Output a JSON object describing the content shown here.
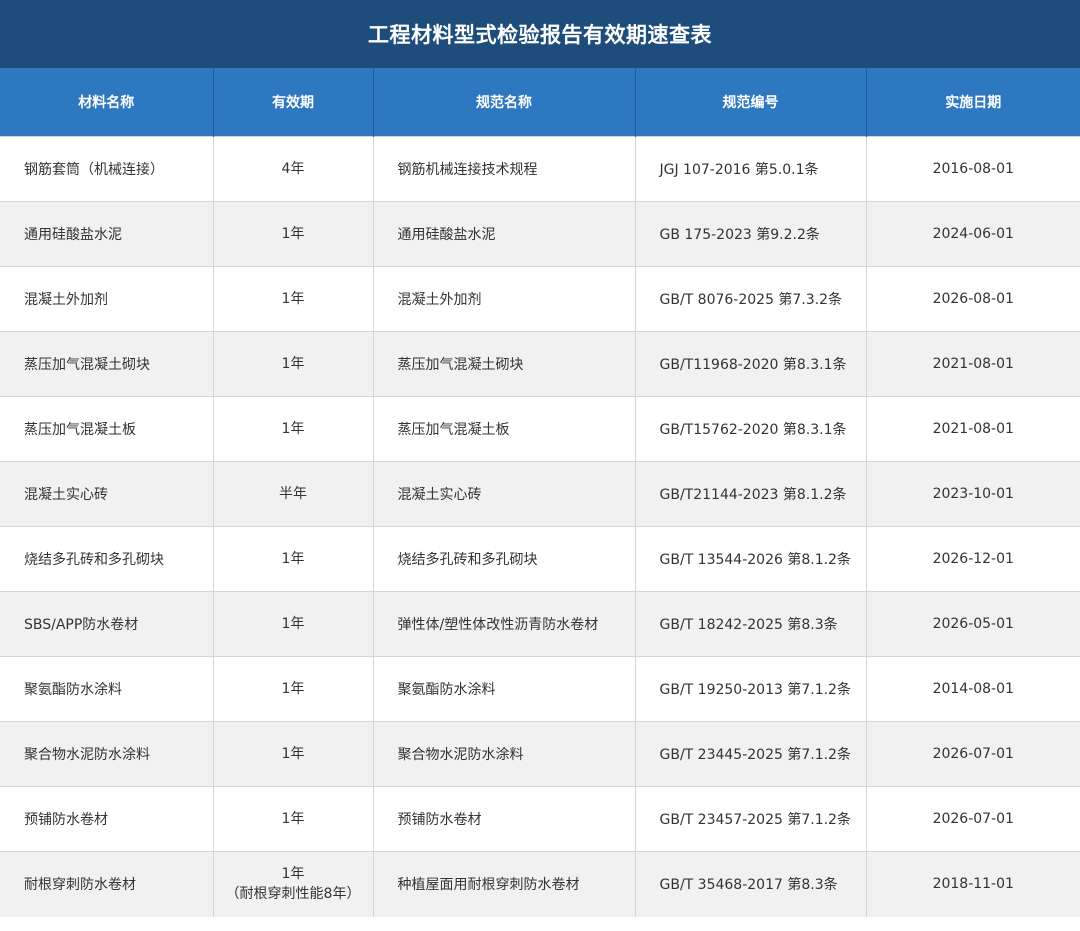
{
  "title": "工程材料型式检验报告有效期速查表",
  "colors": {
    "title_bg": "#1e4d7b",
    "header_bg": "#2e78c2",
    "row_alt_bg": "#f1f1f1"
  },
  "headers": [
    "材料名称",
    "有效期",
    "规范名称",
    "规范编号",
    "实施日期"
  ],
  "rows": [
    {
      "material": "钢筋套筒（机械连接）",
      "period": "4年",
      "period_note": "",
      "spec_name": "钢筋机械连接技术规程",
      "spec_no": "JGJ 107-2016 第5.0.1条",
      "date": "2016-08-01"
    },
    {
      "material": "通用硅酸盐水泥",
      "period": "1年",
      "period_note": "",
      "spec_name": "通用硅酸盐水泥",
      "spec_no": "GB 175-2023 第9.2.2条",
      "date": "2024-06-01"
    },
    {
      "material": "混凝土外加剂",
      "period": "1年",
      "period_note": "",
      "spec_name": "混凝土外加剂",
      "spec_no": "GB/T 8076-2025 第7.3.2条",
      "date": "2026-08-01"
    },
    {
      "material": "蒸压加气混凝土砌块",
      "period": "1年",
      "period_note": "",
      "spec_name": "蒸压加气混凝土砌块",
      "spec_no": "GB/T11968-2020 第8.3.1条",
      "date": "2021-08-01"
    },
    {
      "material": "蒸压加气混凝土板",
      "period": "1年",
      "period_note": "",
      "spec_name": "蒸压加气混凝土板",
      "spec_no": "GB/T15762-2020 第8.3.1条",
      "date": "2021-08-01"
    },
    {
      "material": "混凝土实心砖",
      "period": "半年",
      "period_note": "",
      "spec_name": "混凝土实心砖",
      "spec_no": "GB/T21144-2023 第8.1.2条",
      "date": "2023-10-01"
    },
    {
      "material": "烧结多孔砖和多孔砌块",
      "period": "1年",
      "period_note": "",
      "spec_name": "烧结多孔砖和多孔砌块",
      "spec_no": "GB/T 13544-2026 第8.1.2条",
      "date": "2026-12-01"
    },
    {
      "material": "SBS/APP防水卷材",
      "period": "1年",
      "period_note": "",
      "spec_name": "弹性体/塑性体改性沥青防水卷材",
      "spec_no": "GB/T 18242-2025 第8.3条",
      "date": "2026-05-01"
    },
    {
      "material": "聚氨酯防水涂料",
      "period": "1年",
      "period_note": "",
      "spec_name": "聚氨酯防水涂料",
      "spec_no": "GB/T 19250-2013 第7.1.2条",
      "date": "2014-08-01"
    },
    {
      "material": "聚合物水泥防水涂料",
      "period": "1年",
      "period_note": "",
      "spec_name": "聚合物水泥防水涂料",
      "spec_no": "GB/T 23445-2025 第7.1.2条",
      "date": "2026-07-01"
    },
    {
      "material": "预铺防水卷材",
      "period": "1年",
      "period_note": "",
      "spec_name": "预铺防水卷材",
      "spec_no": "GB/T 23457-2025 第7.1.2条",
      "date": "2026-07-01"
    },
    {
      "material": "耐根穿刺防水卷材",
      "period": "1年",
      "period_note": "（耐根穿刺性能8年）",
      "spec_name": "种植屋面用耐根穿刺防水卷材",
      "spec_no": "GB/T 35468-2017 第8.3条",
      "date": "2018-11-01"
    }
  ]
}
